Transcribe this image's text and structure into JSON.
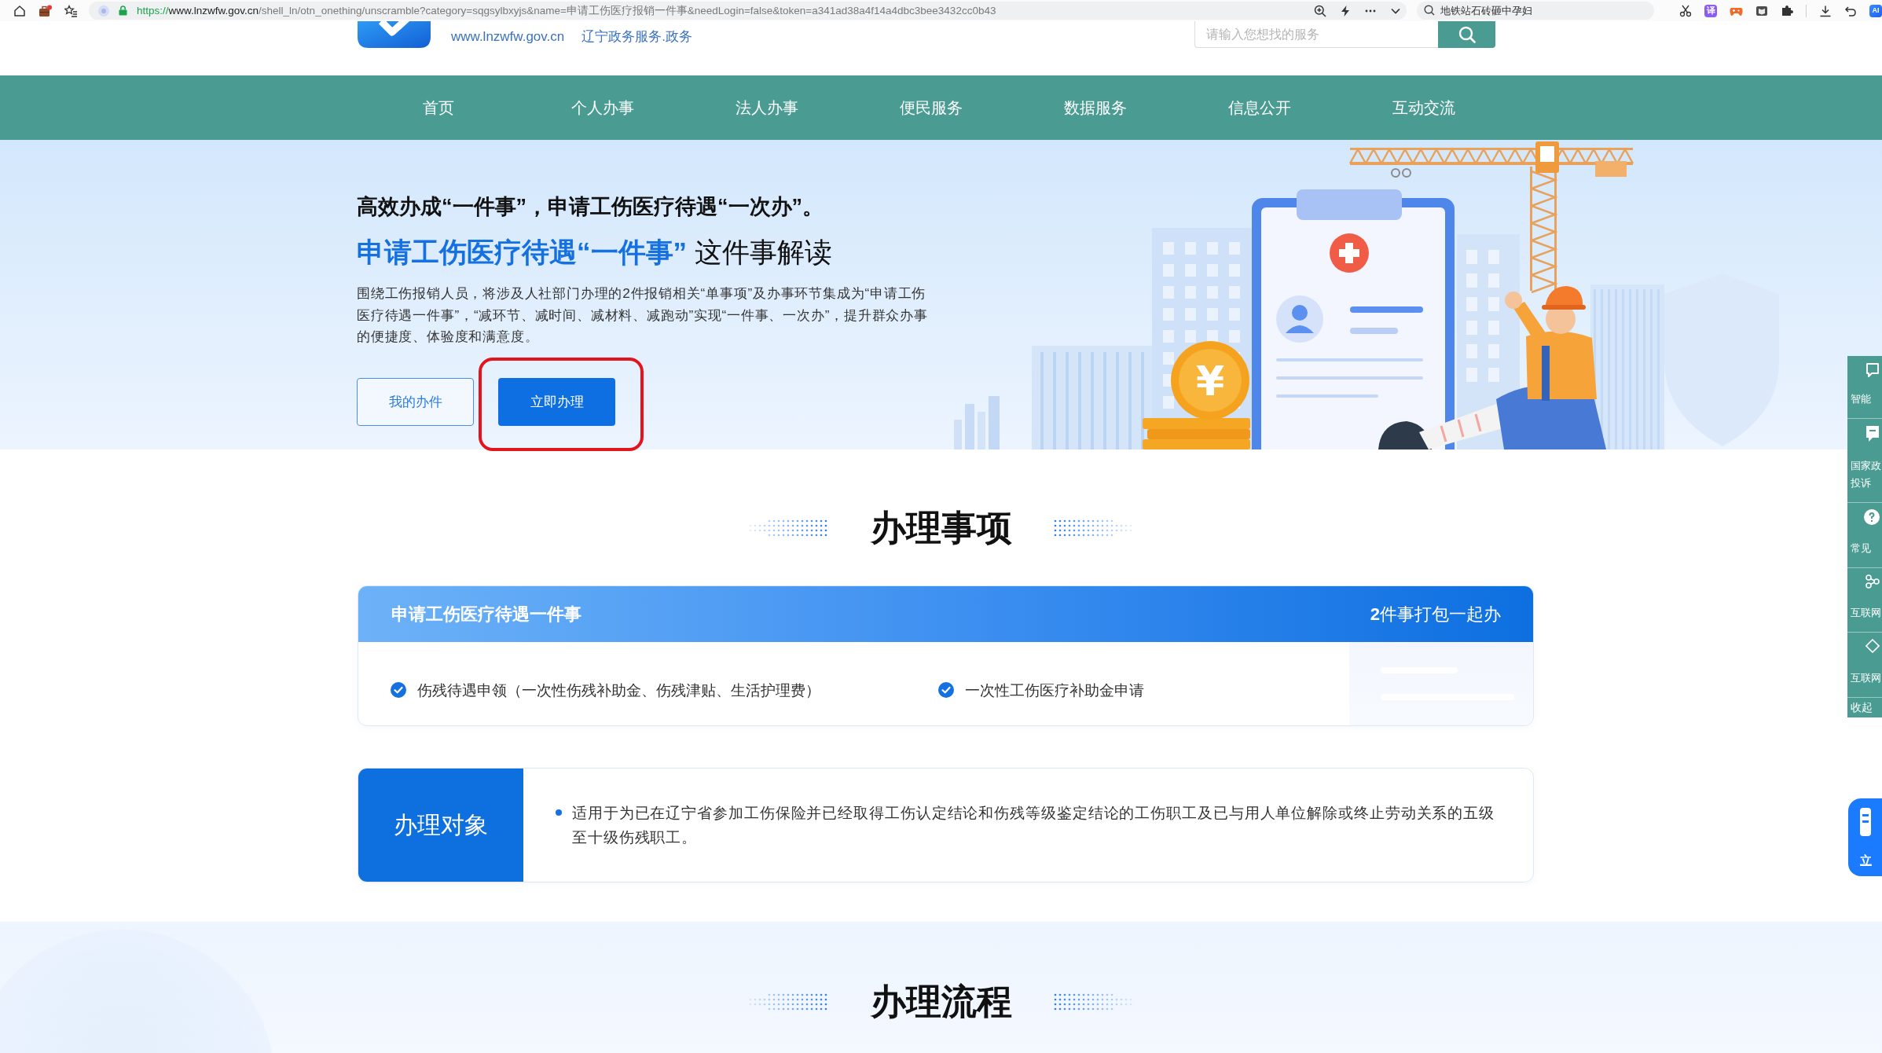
{
  "browser": {
    "url": {
      "scheme": "https://",
      "host": "www.lnzwfw.gov.cn",
      "path": "/shell_ln/otn_onething/unscramble?category=sqgsylbxyjs&name=申请工伤医疗报销一件事&needLogin=false&token=a341ad38a4f14a4dbc3bee3432cc0b43"
    },
    "search": {
      "placeholder": "地铁站石砖砸中孕妇"
    },
    "translate_label": "译",
    "ai_label": "AI"
  },
  "header": {
    "site_url": "www.lnzwfw.gov.cn",
    "slogan": "辽宁政务服务.政务",
    "search": {
      "placeholder": "请输入您想找的服务"
    }
  },
  "nav": [
    {
      "label": "首页",
      "selected": false
    },
    {
      "label": "个人办事",
      "selected": false
    },
    {
      "label": "法人办事",
      "selected": false
    },
    {
      "label": "便民服务",
      "selected": false
    },
    {
      "label": "数据服务",
      "selected": false
    },
    {
      "label": "信息公开",
      "selected": false
    },
    {
      "label": "互动交流",
      "selected": false
    }
  ],
  "hero": {
    "headline": "高效办成“一件事”，申请工伤医疗待遇“一次办”。",
    "title": {
      "highlight": "申请工伤医疗待遇“一件事”",
      "rest": "这件事解读"
    },
    "description": "围绕工伤报销人员，将涉及人社部门办理的2件报销相关“单事项”及办事环节集成为“申请工伤医疗待遇一件事”，“减环节、减时间、减材料、减跑动”实现“一件事、一次办”，提升群众办事的便捷度、体验度和满意度。",
    "buttons": [
      {
        "label": "我的办件",
        "kind": "outline",
        "highlighted": false
      },
      {
        "label": "立即办理",
        "kind": "primary",
        "highlighted": true
      }
    ],
    "coin_symbol": "¥"
  },
  "sidebar": {
    "items": [
      {
        "lines": [
          "智能"
        ]
      },
      {
        "lines": [
          "国家政",
          "投诉"
        ]
      },
      {
        "lines": [
          "常见"
        ]
      },
      {
        "lines": [
          "互联网"
        ]
      },
      {
        "lines": [
          "互联网"
        ]
      }
    ],
    "collapse_label": "收起"
  },
  "float_button": {
    "label": "立"
  },
  "matters": {
    "title": "办理事项",
    "package": {
      "title": "申请工伤医疗待遇一件事",
      "summary": "**2**件事打包一起办",
      "items": [
        "伤残待遇申领（一次性伤残补助金、伤残津贴、生活护理费）",
        "一次性工伤医疗补助金申请"
      ]
    },
    "target": {
      "label": "办理对象",
      "points": [
        "适用于为已在辽宁省参加工伤保险并已经取得工伤认定结论和伤残等级鉴定结论的工伤职工及已与用人单位解除或终止劳动关系的五级至十级伤残职工。"
      ]
    }
  },
  "process": {
    "title": "办理流程"
  }
}
